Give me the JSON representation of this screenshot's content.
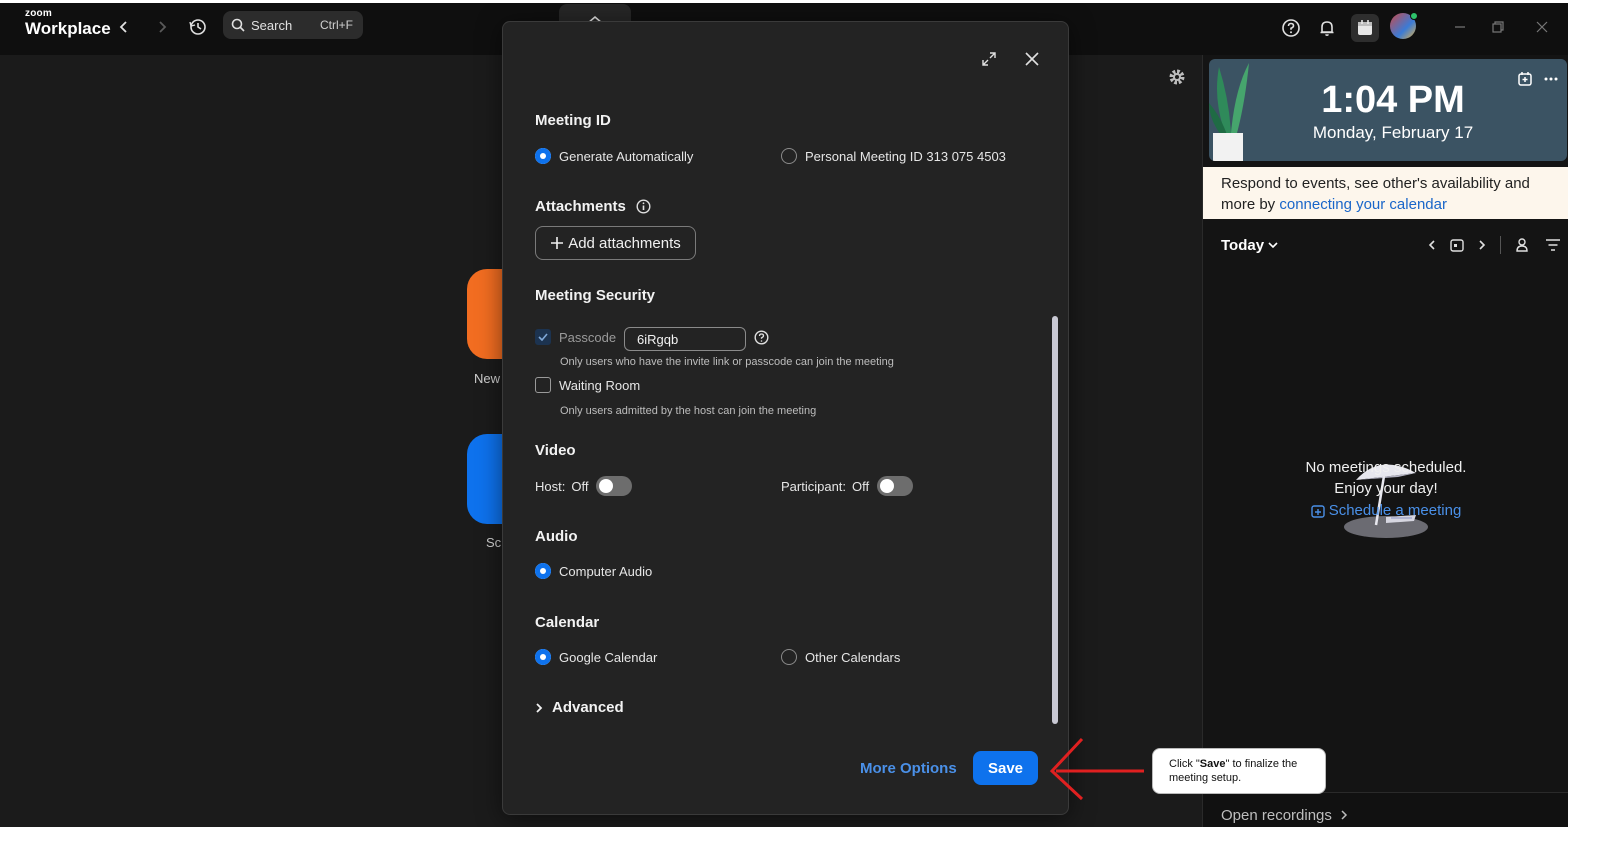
{
  "app": {
    "logo_top": "zoom",
    "logo_bottom": "Workplace",
    "search_label": "Search",
    "search_shortcut": "Ctrl+F"
  },
  "home": {
    "new_meeting_label": "New",
    "schedule_label": "Sch",
    "new_meeting_color": "#f26d21",
    "schedule_color": "#0e72ed"
  },
  "calendar_panel": {
    "time": "1:04 PM",
    "date": "Monday, February 17",
    "notice_text": "Respond to events, see other's availability and more by",
    "notice_link": "connecting your calendar",
    "today_label": "Today",
    "empty_line1": "No meetings scheduled.",
    "empty_line2": "Enjoy your day!",
    "schedule_link": "Schedule a meeting",
    "open_recordings": "Open recordings"
  },
  "modal": {
    "meeting_id": {
      "title": "Meeting ID",
      "opt_auto": "Generate Automatically",
      "opt_personal": "Personal Meeting ID 313 075 4503",
      "selected": "auto"
    },
    "attachments": {
      "title": "Attachments",
      "add_button": "Add attachments"
    },
    "security": {
      "title": "Meeting Security",
      "passcode_label": "Passcode",
      "passcode_value": "6iRgqb",
      "passcode_checked": true,
      "passcode_hint": "Only users who have the invite link or passcode can join the meeting",
      "waiting_room_label": "Waiting Room",
      "waiting_room_checked": false,
      "waiting_room_hint": "Only users admitted by the host can join the meeting"
    },
    "video": {
      "title": "Video",
      "host_label": "Host:",
      "host_state": "Off",
      "participant_label": "Participant:",
      "participant_state": "Off"
    },
    "audio": {
      "title": "Audio",
      "option": "Computer Audio"
    },
    "calendar": {
      "title": "Calendar",
      "opt_google": "Google Calendar",
      "opt_other": "Other Calendars",
      "selected": "google"
    },
    "advanced_label": "Advanced",
    "more_options": "More Options",
    "save": "Save"
  },
  "annotation": {
    "prefix": "Click \"",
    "bold": "Save",
    "suffix": "\" to finalize the meeting setup.",
    "arrow_color": "#e02020"
  }
}
